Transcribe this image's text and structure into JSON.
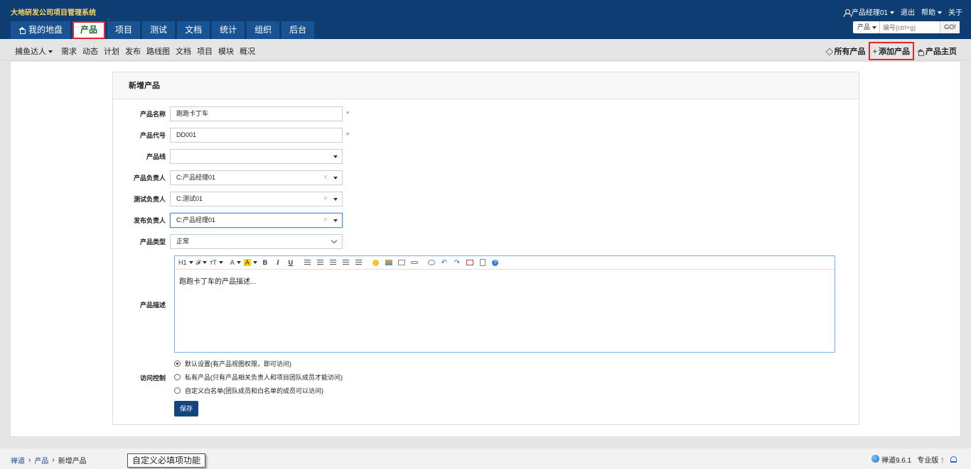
{
  "header": {
    "app_title": "大地研发公司项目管理系统",
    "user_name": "产品经理01",
    "logout": "退出",
    "help": "帮助",
    "about": "关于"
  },
  "main_nav": [
    {
      "label": "我的地盘"
    },
    {
      "label": "产品"
    },
    {
      "label": "项目"
    },
    {
      "label": "测试"
    },
    {
      "label": "文档"
    },
    {
      "label": "统计"
    },
    {
      "label": "组织"
    },
    {
      "label": "后台"
    }
  ],
  "search": {
    "type": "产品",
    "placeholder": "编号(ctrl+g)",
    "go": "GO!"
  },
  "subnav": {
    "product_switch": "捕鱼达人",
    "items": [
      "需求",
      "动态",
      "计划",
      "发布",
      "路线图",
      "文档",
      "项目",
      "模块",
      "概况"
    ],
    "all_products": "所有产品",
    "add_product": "添加产品",
    "product_home": "产品主页"
  },
  "form": {
    "title": "新增产品",
    "name_label": "产品名称",
    "name_value": "跑跑卡丁车",
    "code_label": "产品代号",
    "code_value": "DD001",
    "line_label": "产品线",
    "line_value": "",
    "po_label": "产品负责人",
    "po_value": "C:产品经理01",
    "qd_label": "测试负责人",
    "qd_value": "C:测试01",
    "rd_label": "发布负责人",
    "rd_value": "C:产品经理01",
    "type_label": "产品类型",
    "type_value": "正常",
    "desc_label": "产品描述",
    "desc_value": "跑跑卡丁车的产品描述...",
    "acl_label": "访问控制",
    "acl_options": [
      "默认设置(有产品视图权限，即可访问)",
      "私有产品(只有产品相关负责人和项目团队成员才能访问)",
      "自定义白名单(团队成员和白名单的成员可以访问)"
    ],
    "save": "保存"
  },
  "editor_toolbar": {
    "heading": "H1",
    "font": "𝓕",
    "size": "тT",
    "color": "A",
    "highlight": "A",
    "bold": "B",
    "italic": "I",
    "underline": "U",
    "help": "?"
  },
  "footer": {
    "crumb_home": "禅道",
    "crumb_product": "产品",
    "crumb_current": "新增产品",
    "version": "禅道9.6.1",
    "edition": "专业版"
  },
  "tooltip": "自定义必填项功能",
  "colors": {
    "header_bg": "#0e3d73",
    "nav_tab_bg": "#1a5393",
    "title_yellow": "#ffd75e",
    "highlight_red": "#e0282e",
    "save_button": "#12447e"
  }
}
